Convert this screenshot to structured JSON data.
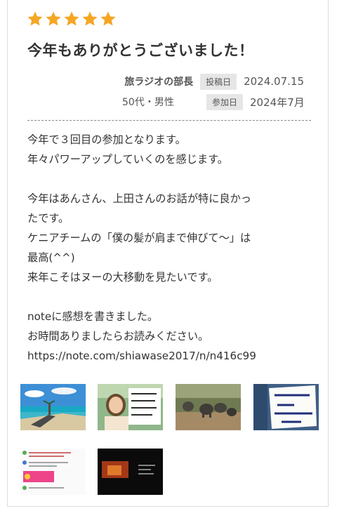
{
  "review": {
    "rating": 5,
    "title": "今年もありがとうございました！",
    "author": "旅ラジオの部長",
    "age_gender": "50代・男性",
    "posted_label": "投稿日",
    "posted_date": "2024.07.15",
    "joined_label": "参加日",
    "joined_date": "2024年7月",
    "body_lines": [
      "今年で３回目の参加となります。",
      "年々パワーアップしていくのを感じます。",
      "",
      "今年はあんさん、上田さんのお話が特に良かっ",
      "たです。",
      "ケニアチームの「僕の髪が肩まで伸びて〜」は",
      "最高(^^)",
      "来年こそはヌーの大移動を見たいです。",
      "",
      "noteに感想を書きました。",
      "お時間ありましたらお読みください。",
      "https://note.com/shiawase2017/n/n416c99"
    ],
    "photos": [
      {
        "icon": "beach-photo"
      },
      {
        "icon": "woman-handwritten-sign-photo"
      },
      {
        "icon": "elephants-photo"
      },
      {
        "icon": "handwritten-message-photo"
      },
      {
        "icon": "chat-screenshot-photo"
      },
      {
        "icon": "video-screenshot-photo"
      }
    ],
    "colors": {
      "star": "#F5A623",
      "badge_bg": "#E6E6E6",
      "text": "#333333"
    }
  }
}
